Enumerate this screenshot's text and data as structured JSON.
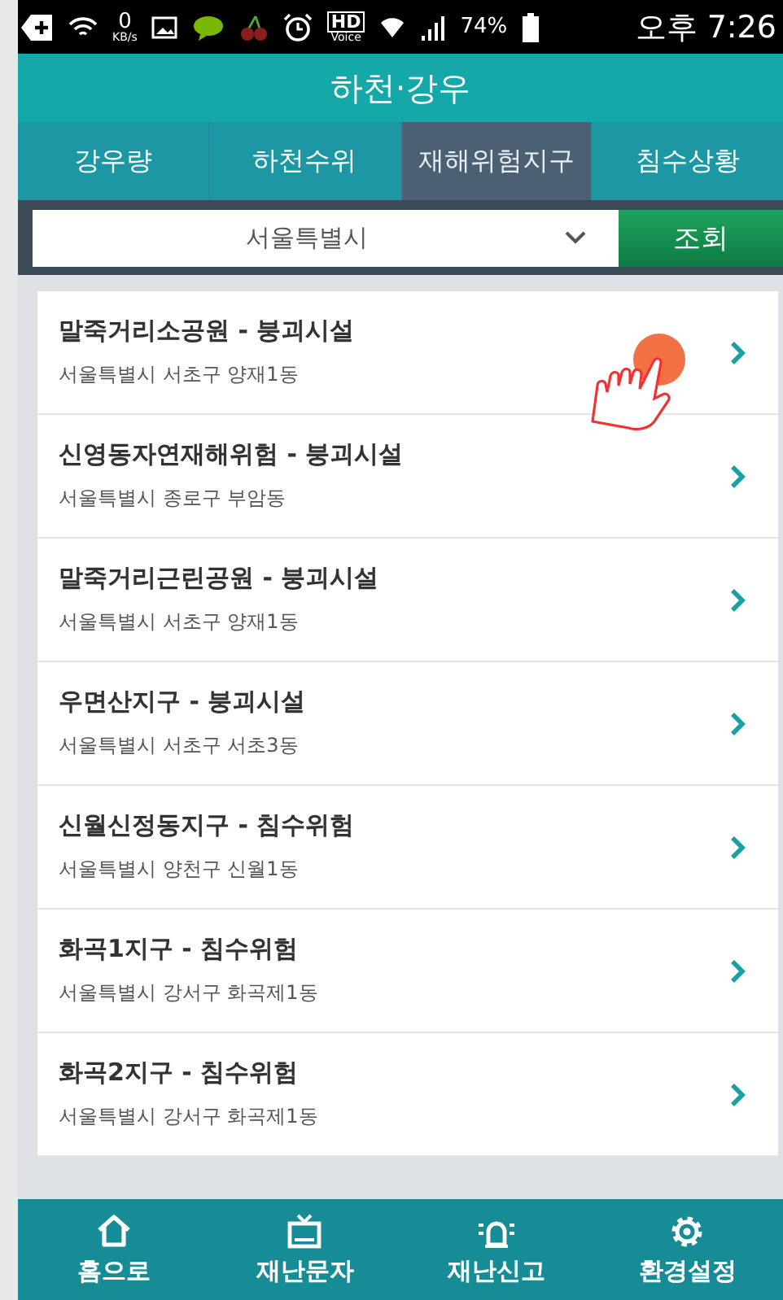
{
  "status_bar": {
    "speed": "0",
    "speed_unit": "KB/s",
    "hd": "HD",
    "voice": "Voice",
    "battery": "74%",
    "time": "오후 7:26"
  },
  "header": {
    "title": "하천·강우"
  },
  "tabs": [
    {
      "label": "강우량",
      "selected": false
    },
    {
      "label": "하천수위",
      "selected": false
    },
    {
      "label": "재해위험지구",
      "selected": true
    },
    {
      "label": "침수상황",
      "selected": false
    }
  ],
  "search": {
    "region": "서울특별시",
    "button": "조회"
  },
  "items": [
    {
      "title": "말죽거리소공원 - 붕괴시설",
      "address": "서울특별시 서초구 양재1동"
    },
    {
      "title": "신영동자연재해위험 - 붕괴시설",
      "address": "서울특별시 종로구 부암동"
    },
    {
      "title": "말죽거리근린공원 - 붕괴시설",
      "address": "서울특별시 서초구 양재1동"
    },
    {
      "title": "우면산지구 - 붕괴시설",
      "address": "서울특별시 서초구 서초3동"
    },
    {
      "title": "신월신정동지구 - 침수위험",
      "address": "서울특별시 양천구 신월1동"
    },
    {
      "title": "화곡1지구 - 침수위험",
      "address": "서울특별시 강서구 화곡제1동"
    },
    {
      "title": "화곡2지구 - 침수위험",
      "address": "서울특별시 강서구 화곡제1동"
    }
  ],
  "bottom_nav": [
    {
      "kind": "home",
      "label": "홈으로"
    },
    {
      "kind": "tv",
      "label": "재난문자"
    },
    {
      "kind": "siren",
      "label": "재난신고"
    },
    {
      "kind": "gear",
      "label": "환경설정"
    }
  ]
}
